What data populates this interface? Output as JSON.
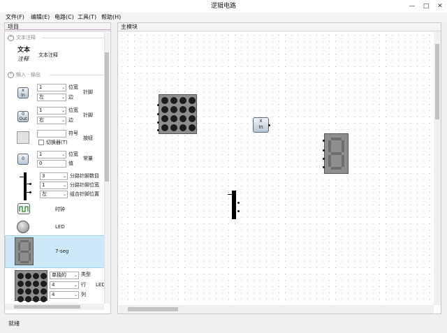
{
  "window": {
    "title": "逻辑电路",
    "min_icon": "minimize-icon",
    "max_icon": "maximize-icon",
    "close_icon": "close-icon"
  },
  "menu": [
    "文件(F)",
    "编辑(E)",
    "电路(C)",
    "工具(T)",
    "帮助(H)"
  ],
  "left_panel": {
    "title": "项目",
    "text_section": {
      "header": "文本注释",
      "big_text": "文本",
      "italic_text": "注释",
      "label": "文本注释"
    },
    "io_section": {
      "header": "输入 - 输出"
    },
    "pin_in": {
      "icon_text_top": "x",
      "icon_text_bottom": "In",
      "width_value": "1",
      "side_value": "左",
      "width_label": "位宽",
      "side_label": "边",
      "name": "针脚"
    },
    "pin_out": {
      "icon_text_top": "0",
      "icon_text_bottom": "Out",
      "width_value": "1",
      "side_value": "右",
      "width_label": "位宽",
      "side_label": "边",
      "name": "针脚"
    },
    "button": {
      "symbol_label": "符号",
      "toggle_label": "切换器(T)",
      "name": "按钮",
      "symbol_value": ""
    },
    "constant": {
      "icon_text": "0",
      "width_value": "1",
      "value_value": "0",
      "width_label": "位宽",
      "value_label": "值",
      "name": "常量"
    },
    "splitter": {
      "count_value": "3",
      "width_value": "1",
      "side_value": "左",
      "count_label": "分路针脚数目",
      "width_label": "分路针脚位宽",
      "side_label": "组合针脚位置"
    },
    "clock": {
      "name": "时钟"
    },
    "led": {
      "name": "LED"
    },
    "seven_seg": {
      "name": "7-seg"
    },
    "led_matrix": {
      "type_value": "单独的",
      "rows_value": "4",
      "cols_value": "4",
      "type_label": "类型",
      "rows_label": "行",
      "cols_label": "列",
      "name": "LED"
    }
  },
  "canvas": {
    "title": "主模块",
    "pin_text_top": "x",
    "pin_text_bottom": "In"
  },
  "status": {
    "text": "就绪"
  },
  "colors": {
    "selection": "#cde8f7",
    "component_gray": "#8d8f8e",
    "pin_blue": "#c7d5e2"
  }
}
